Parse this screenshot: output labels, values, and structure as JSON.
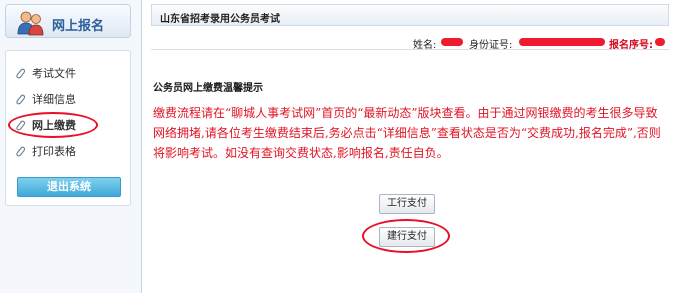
{
  "sidebar": {
    "title": "网上报名",
    "items": [
      {
        "label": "考试文件",
        "icon": "paperclip-icon"
      },
      {
        "label": "详细信息",
        "icon": "paperclip-icon"
      },
      {
        "label": "网上缴费",
        "icon": "paperclip-icon",
        "active": true
      },
      {
        "label": "打印表格",
        "icon": "paperclip-icon"
      }
    ],
    "logout_label": "退出系统"
  },
  "header": {
    "title": "山东省招考录用公务员考试"
  },
  "info_bar": {
    "name_label": "姓名:",
    "id_label": "身份证号:",
    "reg_label": "报名序号:"
  },
  "notice": {
    "heading": "公务员网上缴费温馨提示",
    "body": "缴费流程请在“聊城人事考试网”首页的“最新动态”版块查看。由于通过网银缴费的考生很多导致网络拥堵,请各位考生缴费结束后,务必点击“详细信息”查看状态是否为“交费成功,报名完成”,否则将影响考试。如没有查询交费状态,影响报名,责任自负。"
  },
  "buttons": {
    "icbc_label": "工行支付",
    "ccb_label": "建行支付"
  },
  "colors": {
    "accent": "#2a5f98",
    "warning_text": "#e01425",
    "annotation": "#e8102a"
  }
}
